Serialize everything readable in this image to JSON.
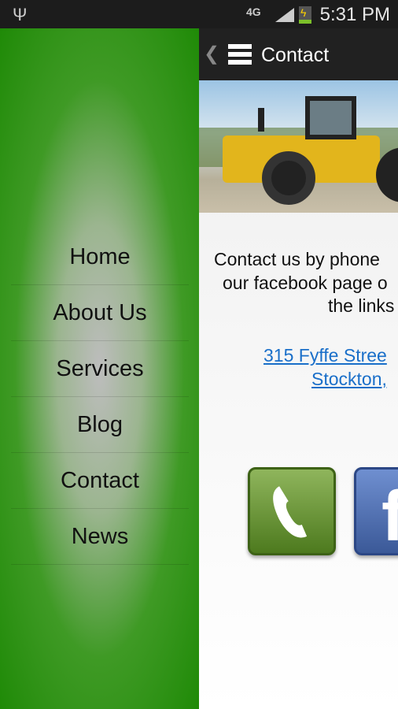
{
  "status_bar": {
    "time": "5:31 PM",
    "network": "4G",
    "icons": [
      "usb-icon",
      "signal-icon",
      "battery-charging-icon"
    ]
  },
  "drawer": {
    "items": [
      {
        "label": "Home"
      },
      {
        "label": "About Us"
      },
      {
        "label": "Services"
      },
      {
        "label": "Blog"
      },
      {
        "label": "Contact"
      },
      {
        "label": "News"
      }
    ]
  },
  "action_bar": {
    "title": "Contact"
  },
  "content": {
    "lines": [
      "Contact us by phone",
      "our facebook page o",
      "the links"
    ],
    "address_lines": [
      "315 Fyffe Stree",
      "Stockton,"
    ],
    "buttons": [
      {
        "icon": "phone-icon",
        "color": "#6a9a35"
      },
      {
        "icon": "facebook-icon",
        "color": "#4a6cb3"
      }
    ]
  }
}
